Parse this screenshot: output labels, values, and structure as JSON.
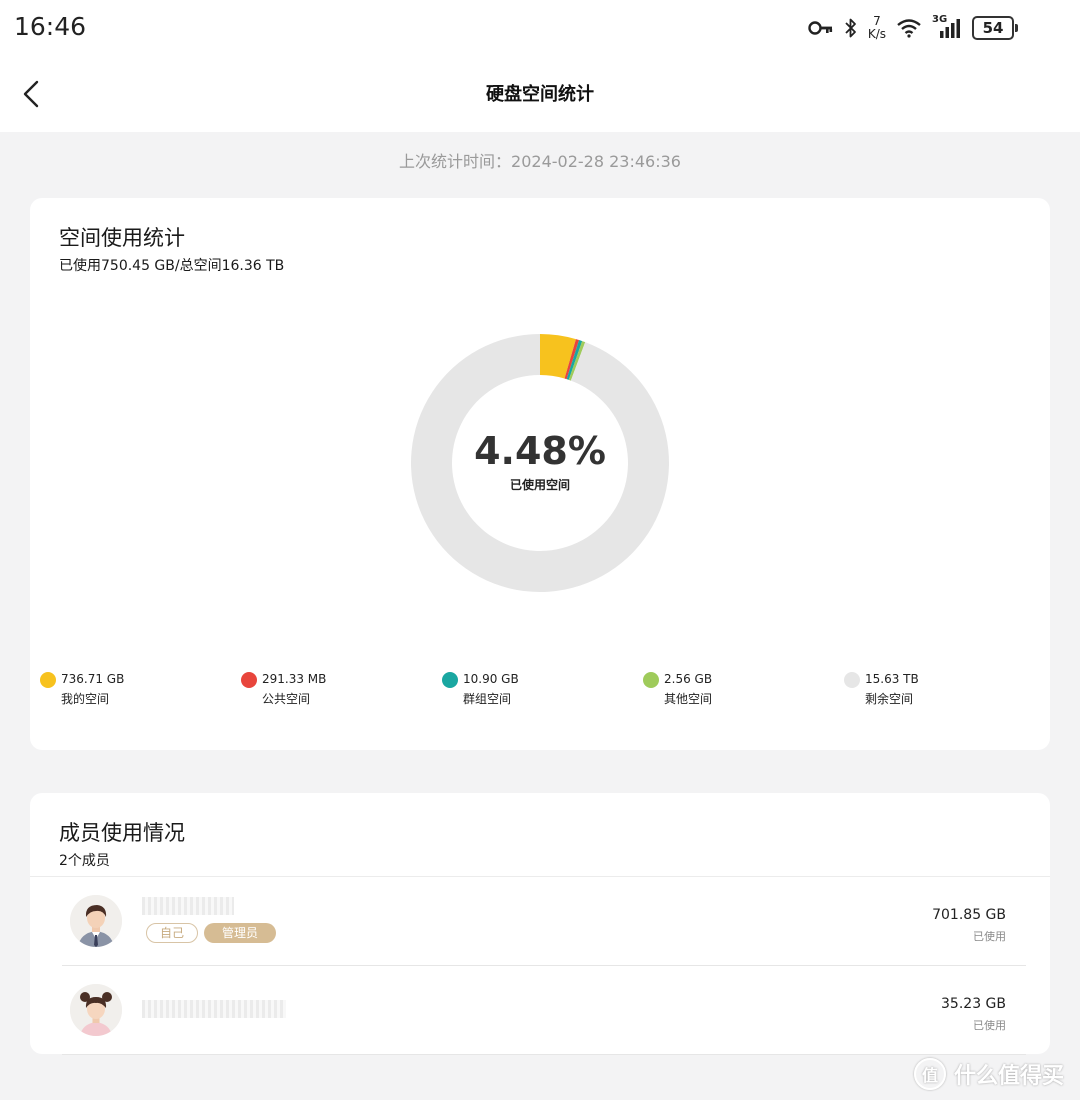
{
  "status_bar": {
    "time": "16:46",
    "net_speed_value": "7",
    "net_speed_unit": "K/s",
    "network_type": "3G",
    "battery": "54",
    "icons": [
      "key-icon",
      "bluetooth-icon",
      "wifi-icon",
      "signal-icon",
      "battery-icon"
    ]
  },
  "header": {
    "title": "硬盘空间统计",
    "back_icon": "chevron-left-icon"
  },
  "last_stat_time": "上次统计时间：2024-02-28 23:46:36",
  "usage_card": {
    "title": "空间使用统计",
    "summary": "已使用750.45 GB/总空间16.36 TB",
    "center_percent": "4.48%",
    "center_caption": "已使用空间"
  },
  "chart_data": {
    "type": "pie",
    "title": "空间使用统计",
    "center_label": "4.48%",
    "unit": "GB",
    "segments": [
      {
        "name": "我的空间",
        "label": "736.71 GB",
        "value": 736.71,
        "color": "#f7c21e"
      },
      {
        "name": "公共空间",
        "label": "291.33 MB",
        "value": 0.29133,
        "color": "#e8453c"
      },
      {
        "name": "群组空间",
        "label": "10.90 GB",
        "value": 10.9,
        "color": "#1aa7a1"
      },
      {
        "name": "其他空间",
        "label": "2.56 GB",
        "value": 2.56,
        "color": "#9fcb5b"
      },
      {
        "name": "剩余空间",
        "label": "15.63 TB",
        "value": 15630,
        "color": "#e6e6e6"
      }
    ]
  },
  "members_card": {
    "title": "成员使用情况",
    "count": "2个成员",
    "members": [
      {
        "size": "701.85 GB",
        "used_label": "已使用",
        "tags": [
          "自己",
          "管理员"
        ],
        "avatar": "male-avatar-icon"
      },
      {
        "size": "35.23 GB",
        "used_label": "已使用",
        "tags": [],
        "avatar": "female-avatar-icon"
      }
    ]
  },
  "watermark": {
    "symbol": "值",
    "text": "什么值得买"
  }
}
